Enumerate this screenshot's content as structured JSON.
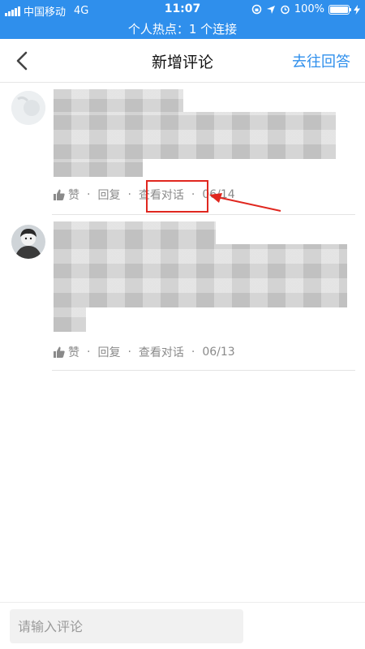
{
  "status_bar": {
    "carrier": "中国移动",
    "network": "4G",
    "time": "11:07",
    "battery": "100%",
    "hotspot": "个人热点：1 个连接"
  },
  "nav": {
    "title": "新增评论",
    "action": "去往回答"
  },
  "comments": [
    {
      "like": "赞",
      "reply": "回复",
      "view": "查看对话",
      "date": "06/14",
      "dot": "·"
    },
    {
      "like": "赞",
      "reply": "回复",
      "view": "查看对话",
      "date": "06/13",
      "dot": "·"
    }
  ],
  "input": {
    "placeholder": "请输入评论"
  },
  "colors": {
    "primary": "#2f8fec",
    "highlight": "#e0271f"
  }
}
